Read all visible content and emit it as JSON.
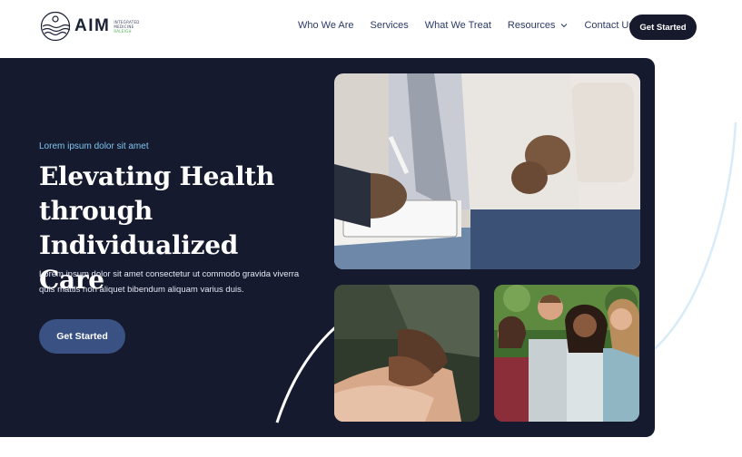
{
  "logo": {
    "word": "AIM",
    "sub_line1": "INTEGRATED",
    "sub_line2": "MEDICINE",
    "sub_line3": "RALEIGH"
  },
  "nav": {
    "items": [
      "Who We Are",
      "Services",
      "What We Treat",
      "Resources",
      "Contact Us"
    ],
    "cta_label": "Get Started"
  },
  "hero": {
    "eyebrow": "Lorem ipsum dolor sit amet",
    "headline": "Elevating Health through Individualized Care",
    "description": "Lorem ipsum dolor sit amet consectetur ut commodo gravida viverra quis mattis non aliquet bibendum aliquam varius duis.",
    "cta_label": "Get Started"
  },
  "icons": {
    "logo": "wave-person-logo-icon",
    "resources_dropdown": "chevron-down-icon"
  },
  "colors": {
    "navy": "#161a2e",
    "accent_blue": "#3a5184",
    "eyebrow": "#7fc6f0",
    "nav_text": "#2b3a67",
    "brand_green": "#4caf50"
  }
}
